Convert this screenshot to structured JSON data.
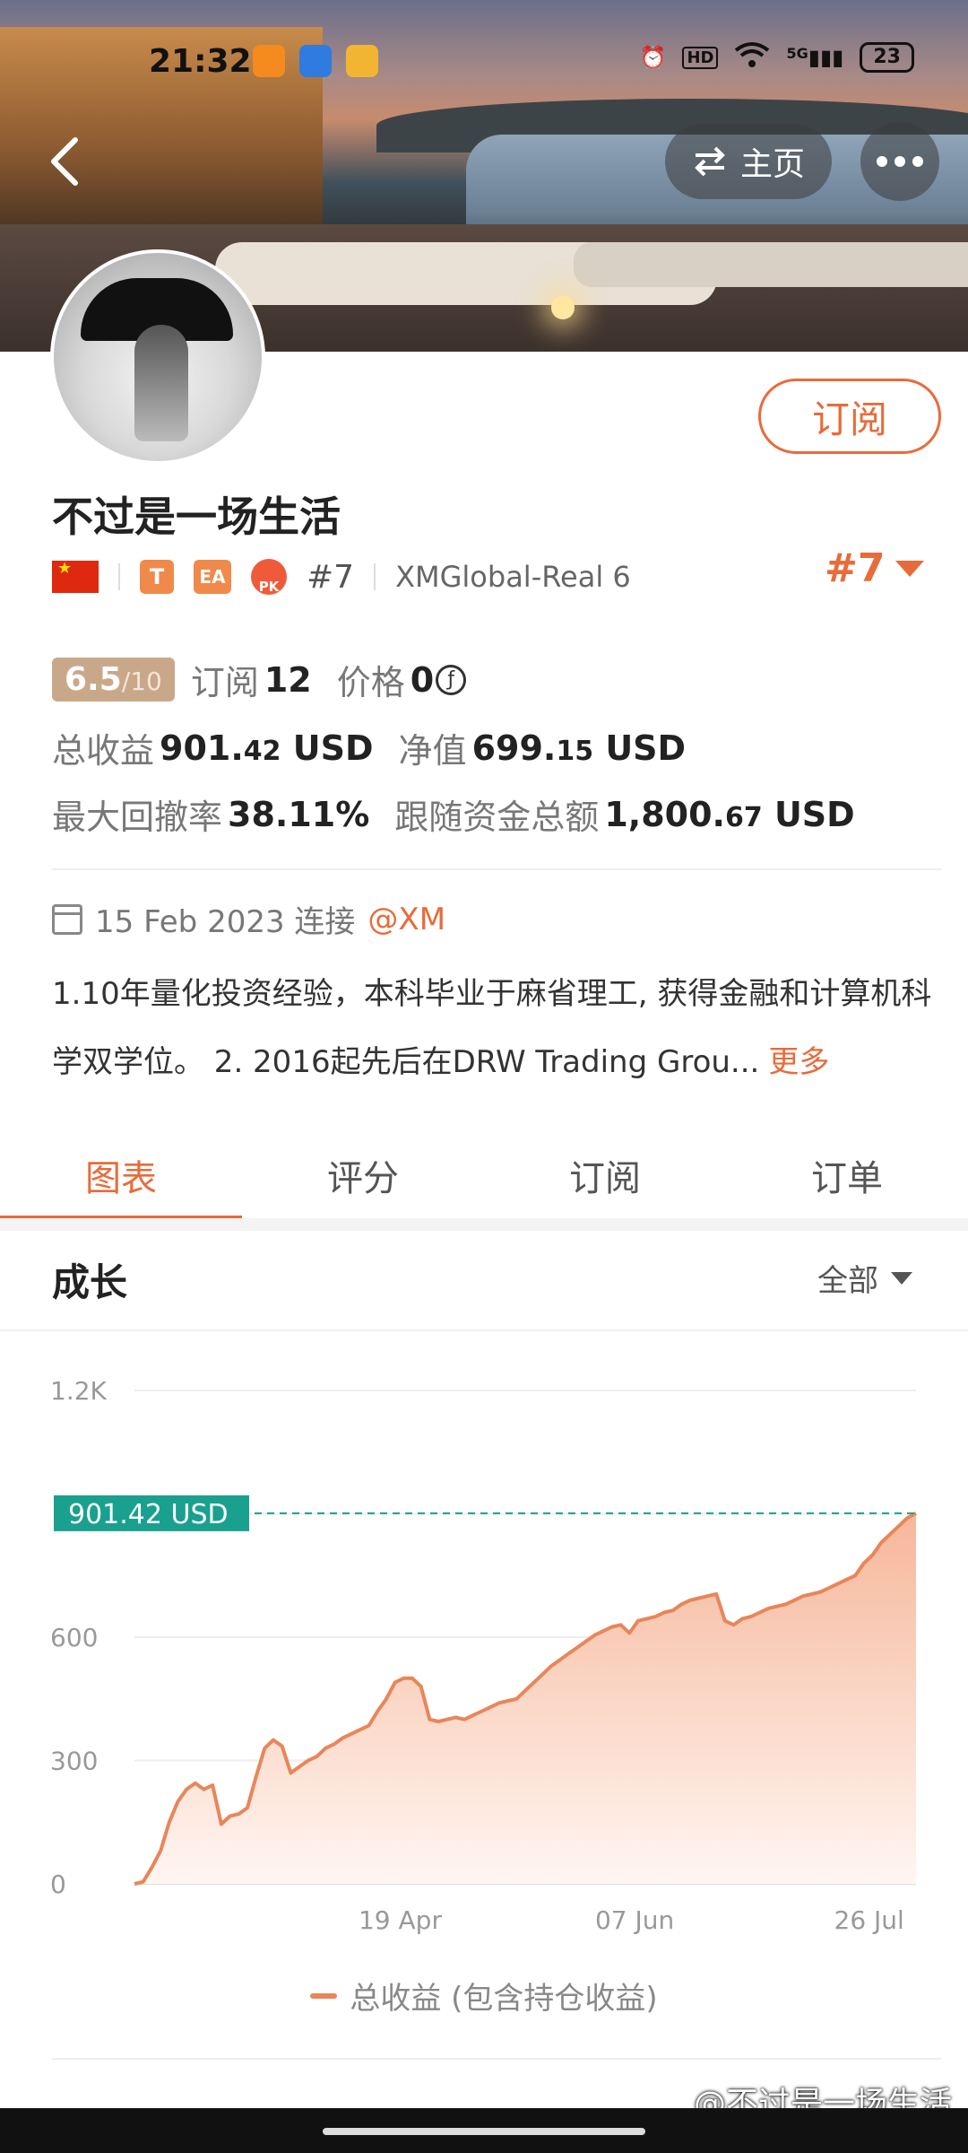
{
  "status_bar": {
    "time": "21:32",
    "battery": "23",
    "network": "5G",
    "hd": "HD"
  },
  "header": {
    "home_label": "主页"
  },
  "profile": {
    "subscribe_label": "订阅",
    "name": "不过是一场生活",
    "tags": {
      "t": "T",
      "ea": "EA",
      "pk": "PK",
      "rank_small": "#7",
      "broker": "XMGlobal-Real 6"
    },
    "rank": "#7"
  },
  "stats": {
    "score": "6.5",
    "score_max": "/10",
    "subscribers_label": "订阅",
    "subscribers": "12",
    "price_label": "价格",
    "price": "0",
    "price_icon": "ƒ",
    "total_profit_label": "总收益",
    "total_profit_int": "901.",
    "total_profit_dec": "42",
    "total_profit_unit": "USD",
    "net_value_label": "净值",
    "net_value_int": "699.",
    "net_value_dec": "15",
    "net_value_unit": "USD",
    "max_drawdown_label": "最大回撤率",
    "max_drawdown": "38.11%",
    "follow_funds_label": "跟随资金总额",
    "follow_funds_int": "1,800.",
    "follow_funds_dec": "67",
    "follow_funds_unit": "USD"
  },
  "join": {
    "date": "15 Feb 2023 连接",
    "broker": "@XM"
  },
  "bio": {
    "text": "1.10年量化投资经验，本科毕业于麻省理工, 获得金融和计算机科学双学位。 2. 2016起先后在DRW Trading Grou...",
    "more": "更多"
  },
  "tabs": [
    "图表",
    "评分",
    "订阅",
    "订单"
  ],
  "growth": {
    "title": "成长",
    "filter": "全部"
  },
  "chart_data": {
    "type": "area",
    "y_ticks": [
      "1.2K",
      "600",
      "300",
      "0"
    ],
    "ylim": [
      0,
      1200
    ],
    "x_ticks": [
      "19 Apr",
      "07 Jun",
      "26 Jul"
    ],
    "current_label": "901.42 USD",
    "current_value": 901.42,
    "series": [
      {
        "name": "总收益 (包含持仓收益)",
        "values": [
          0,
          5,
          40,
          80,
          150,
          200,
          230,
          245,
          230,
          240,
          145,
          165,
          170,
          185,
          260,
          330,
          350,
          335,
          270,
          285,
          300,
          310,
          330,
          340,
          355,
          365,
          375,
          385,
          420,
          450,
          490,
          500,
          500,
          480,
          400,
          395,
          400,
          405,
          400,
          410,
          420,
          430,
          440,
          445,
          450,
          470,
          490,
          510,
          530,
          545,
          560,
          575,
          590,
          605,
          615,
          625,
          630,
          610,
          640,
          645,
          650,
          660,
          665,
          680,
          690,
          695,
          700,
          705,
          640,
          630,
          645,
          650,
          660,
          670,
          675,
          680,
          690,
          700,
          705,
          710,
          720,
          730,
          740,
          750,
          780,
          800,
          830,
          850,
          870,
          890,
          901.42
        ]
      }
    ],
    "legend": "总收益 (包含持仓收益)",
    "colors": {
      "line": "#e8865a",
      "fill_top": "#f6b79a",
      "fill_bottom": "#fff6f2",
      "marker": "#1aa08e",
      "grid": "#eeeeee"
    }
  },
  "watermark": "@不过是一场生活"
}
